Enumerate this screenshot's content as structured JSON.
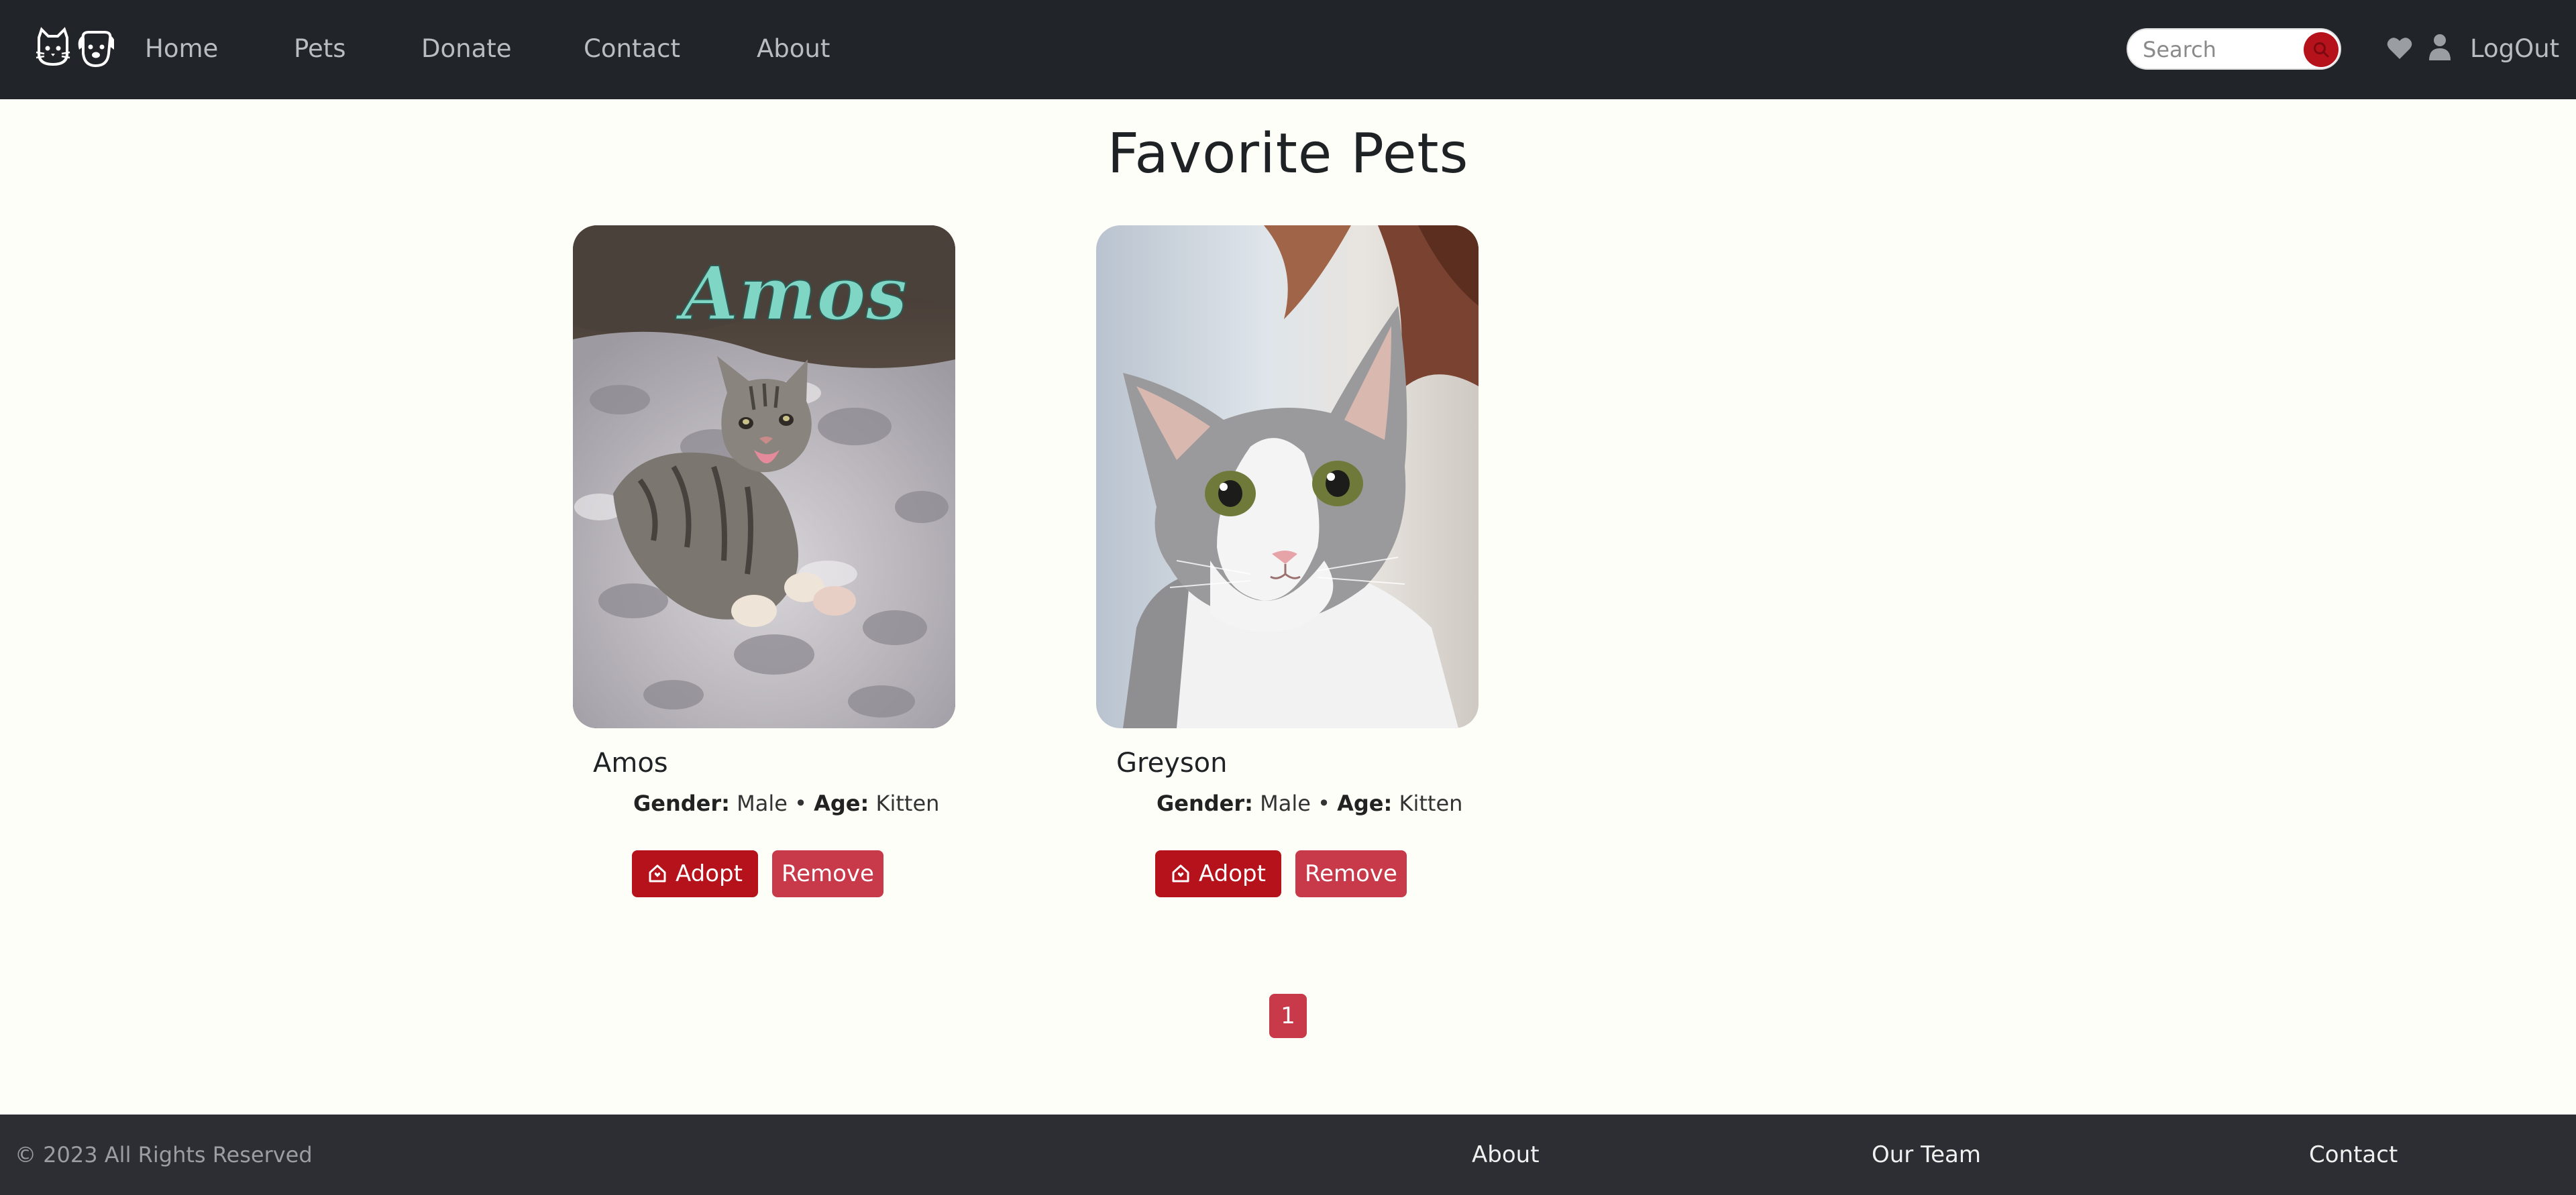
{
  "nav": {
    "links": [
      "Home",
      "Pets",
      "Donate",
      "Contact",
      "About"
    ],
    "search_placeholder": "Search",
    "logout_label": "LogOut"
  },
  "page": {
    "title": "Favorite Pets"
  },
  "pets": [
    {
      "name": "Amos",
      "photo_caption": "Amos",
      "gender_label": "Gender:",
      "gender": "Male",
      "separator": "•",
      "age_label": "Age:",
      "age": "Kitten",
      "adopt_label": "Adopt",
      "remove_label": "Remove"
    },
    {
      "name": "Greyson",
      "gender_label": "Gender:",
      "gender": "Male",
      "separator": "•",
      "age_label": "Age:",
      "age": "Kitten",
      "adopt_label": "Adopt",
      "remove_label": "Remove"
    }
  ],
  "pagination": {
    "current": "1"
  },
  "footer": {
    "copyright": "© 2023 All Rights Reserved",
    "links": [
      "About",
      "Our Team",
      "Contact"
    ]
  },
  "colors": {
    "navbar": "#212529",
    "accent": "#b5121b",
    "remove": "#c8394a",
    "footer": "#2c2e33",
    "background": "#fefef8"
  },
  "icons": {
    "brand": "cat-dog-logo-icon",
    "search": "search-icon",
    "favorites": "heart-icon",
    "account": "user-icon",
    "adopt": "home-icon"
  }
}
